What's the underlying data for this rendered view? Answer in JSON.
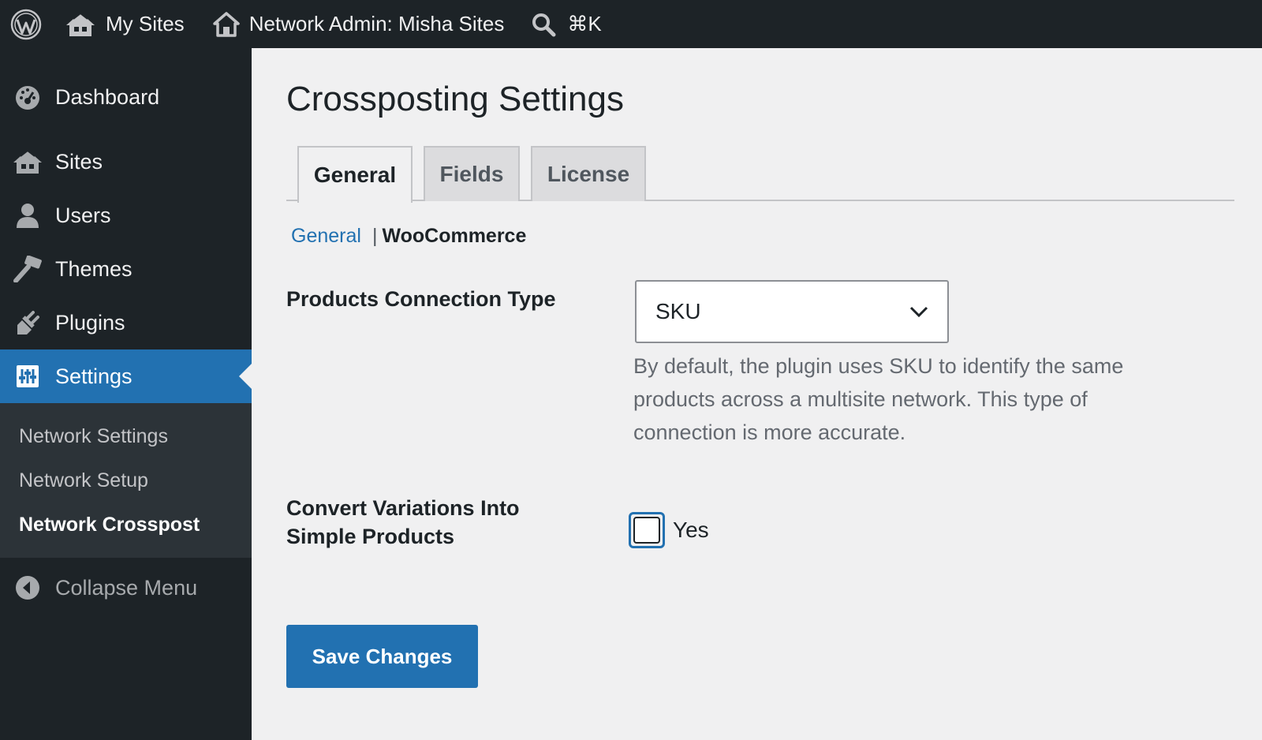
{
  "adminbar": {
    "wp_logo": "wordpress-logo",
    "my_sites": "My Sites",
    "network_admin": "Network Admin: Misha Sites",
    "search_shortcut": "⌘K"
  },
  "sidebar": {
    "items": [
      {
        "label": "Dashboard",
        "icon": "dashboard-icon"
      },
      {
        "label": "Sites",
        "icon": "sites-icon"
      },
      {
        "label": "Users",
        "icon": "users-icon"
      },
      {
        "label": "Themes",
        "icon": "themes-icon"
      },
      {
        "label": "Plugins",
        "icon": "plugins-icon"
      },
      {
        "label": "Settings",
        "icon": "settings-icon",
        "active": true
      }
    ],
    "submenu": [
      "Network Settings",
      "Network Setup",
      "Network Crosspost"
    ],
    "collapse": "Collapse Menu"
  },
  "main": {
    "title": "Crossposting Settings",
    "tabs": [
      "General",
      "Fields",
      "License"
    ],
    "subnav": {
      "general": "General",
      "separator": "|",
      "current": "WooCommerce"
    },
    "connection_type": {
      "label": "Products Connection Type",
      "selected": "SKU",
      "description": "By default, the plugin uses SKU to identify the same products across a multisite network. This type of connection is more accurate."
    },
    "convert_variations": {
      "label_line1": "Convert Variations Into",
      "label_line2": "Simple Products",
      "checkbox_label": "Yes",
      "checked": false
    },
    "save_label": "Save Changes"
  },
  "colors": {
    "adminbar_bg": "#1d2327",
    "accent": "#2271b1",
    "content_bg": "#f0f0f1"
  }
}
